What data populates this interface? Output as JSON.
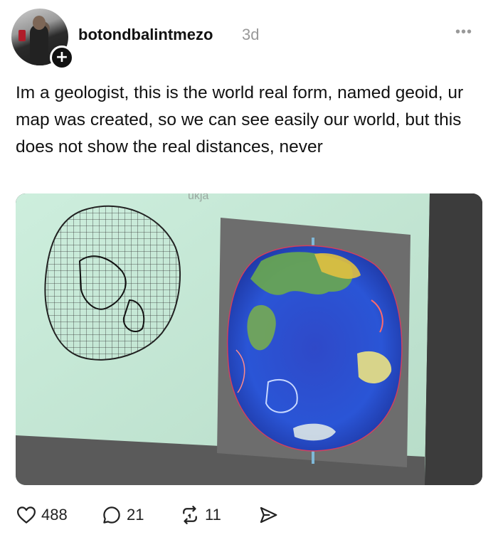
{
  "post": {
    "username": "botondbalintmezo",
    "time": "3d",
    "more_icon": "more-horizontal-icon",
    "follow_icon": "plus-icon",
    "caption": "Im a geologist, this is the world real form, named geoid, ur map was created, so we can see easily our world, but this does not show the real distances, never",
    "image_overlay_text": "ukja",
    "stats": {
      "likes": "488",
      "comments": "21",
      "reposts": "11"
    },
    "icons": {
      "like": "heart-icon",
      "comment": "comment-icon",
      "repost": "repost-icon",
      "share": "share-icon"
    }
  }
}
